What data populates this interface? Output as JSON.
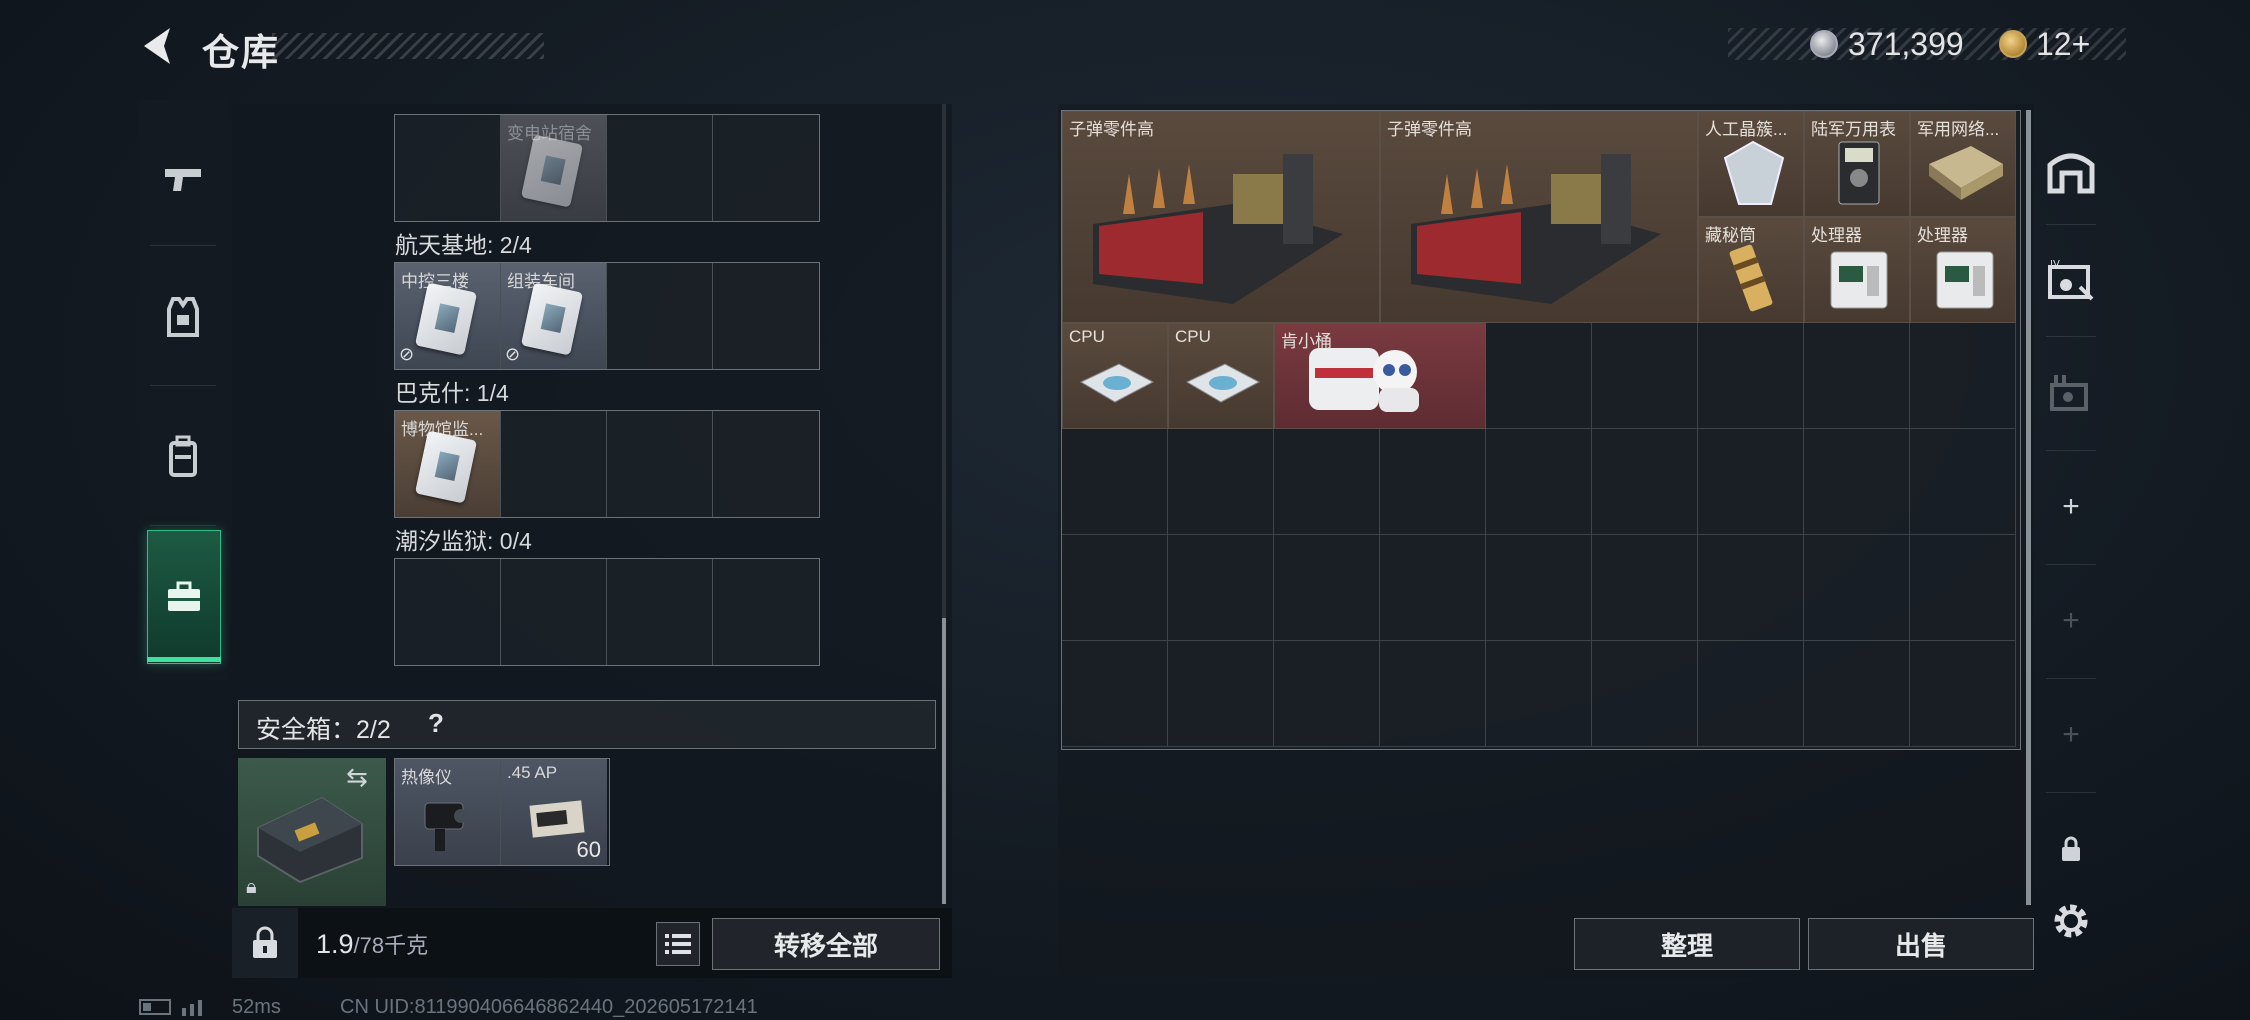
{
  "header": {
    "title": "仓库",
    "money": "371,399",
    "tickets": "12+"
  },
  "left_tabs": [
    {
      "icon": "pistol-icon"
    },
    {
      "icon": "vest-icon"
    },
    {
      "icon": "backpack-icon"
    },
    {
      "icon": "briefcase-icon"
    }
  ],
  "key_section": {
    "top_row_label": "变电站宿舍",
    "groups": [
      {
        "header": "航天基地: 2/4",
        "items": [
          {
            "label": "中控三楼"
          },
          {
            "label": "组装车间"
          }
        ]
      },
      {
        "header": "巴克什: 1/4",
        "items": [
          {
            "label": "博物馆监..."
          }
        ]
      },
      {
        "header": "潮汐监狱: 0/4",
        "items": []
      }
    ]
  },
  "safebox": {
    "label": "安全箱：2/2",
    "help": "?",
    "items": [
      {
        "label": "热像仪"
      },
      {
        "label": ".45 AP",
        "count": "60"
      }
    ]
  },
  "left_bottom": {
    "weight": "1.9",
    "weight_max": "/78千克",
    "transfer_label": "转移全部"
  },
  "stash": {
    "items": [
      {
        "label": "子弹零件高"
      },
      {
        "label": "子弹零件高"
      },
      {
        "label": "人工晶簇..."
      },
      {
        "label": "陆军万用表"
      },
      {
        "label": "军用网络..."
      },
      {
        "label": "藏秘筒"
      },
      {
        "label": "处理器"
      },
      {
        "label": "处理器"
      },
      {
        "label": "CPU"
      },
      {
        "label": "CPU"
      },
      {
        "label": "肯小桶"
      }
    ],
    "organize_label": "整理",
    "sell_label": "出售"
  },
  "right_tabs": [
    "safehouse-icon",
    "key-card-icon",
    "card-holder-icon",
    "+",
    "+",
    "+",
    "lock"
  ],
  "footer": {
    "ping": "52ms",
    "uid": "CN UID:811990406646862440_202605172141"
  }
}
